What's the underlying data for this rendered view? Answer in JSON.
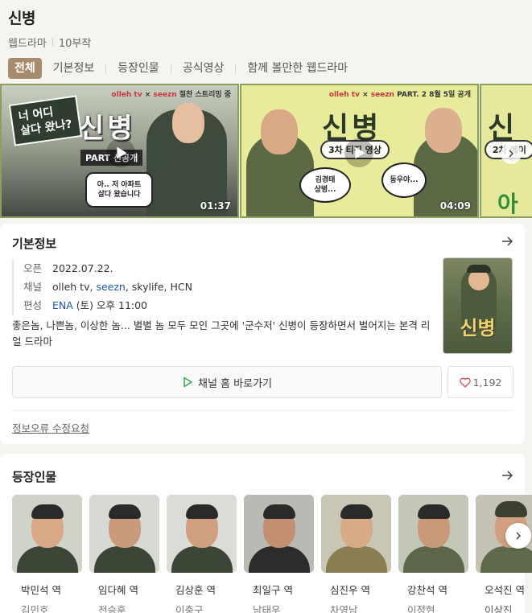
{
  "header": {
    "title": "신병",
    "type": "웹드라마",
    "episodes": "10부작"
  },
  "tabs": [
    {
      "label": "전체",
      "active": true
    },
    {
      "label": "기본정보"
    },
    {
      "label": "등장인물"
    },
    {
      "label": "공식영상"
    },
    {
      "label": "함께 볼만한 웹드라마"
    }
  ],
  "videos": [
    {
      "brand_left": "olleh tv",
      "brand_x": " × ",
      "brand_right": "seezn",
      "brand_suffix": " 절찬 스트리밍 중",
      "title": "신병",
      "sticker": "너 어디\n살다 왔나?",
      "part_label": "PART",
      "part_suffix": "선공개",
      "bubble": "아.. 저 아파트\n살다 왔습니다",
      "duration": "01:37"
    },
    {
      "brand_left": "olleh tv",
      "brand_x": " × ",
      "brand_right": "seezn",
      "brand_suffix": " PART. 2 8월 5일 공개",
      "title": "신병",
      "part_bar": "3차 티징 영상",
      "bubble_left": "김경태\n상병...",
      "bubble_right": "동우야...",
      "duration": "04:09"
    },
    {
      "title": "신",
      "part_bar": "2차 메이",
      "extra": "아"
    }
  ],
  "info": {
    "section_title": "기본정보",
    "rows": [
      {
        "key": "오픈",
        "value": "2022.07.22."
      },
      {
        "key": "채널",
        "value_pre": "olleh tv, ",
        "value_link": "seezn",
        "value_post": ", skylife, HCN"
      },
      {
        "key": "편성",
        "value_link": "ENA",
        "value_post": " (토) 오후 11:00"
      }
    ],
    "description": "좋은놈, 나쁜놈, 이상한 놈... 별별 놈 모두 모인 그곳에 '군수저' 신병이 등장하면서 벌어지는 본격 리얼 드라마",
    "poster_title": "신병",
    "channel_button": "채널 홈 바로가기",
    "like_count": "1,192",
    "report_link": "정보오류 수정요청"
  },
  "cast": {
    "section_title": "등장인물",
    "members": [
      {
        "role": "박민석 역",
        "actor": "김민호",
        "underline": false
      },
      {
        "role": "임다혜 역",
        "actor": "전승훈",
        "underline": false
      },
      {
        "role": "김상훈 역",
        "actor": "이충구",
        "underline": false
      },
      {
        "role": "최일구 역",
        "actor": "남태우",
        "underline": false
      },
      {
        "role": "심진우 역",
        "actor": "차영남",
        "underline": false
      },
      {
        "role": "강찬석 역",
        "actor": "이정현",
        "underline": false
      },
      {
        "role": "오석진 역",
        "actor": "이상진",
        "underline": true
      }
    ]
  },
  "colors": {
    "accent_tab": "#a68c6d",
    "link": "#1f56b8",
    "video_border": "#8aa05c",
    "heart": "#e0455a",
    "play_green": "#2aa84a"
  }
}
